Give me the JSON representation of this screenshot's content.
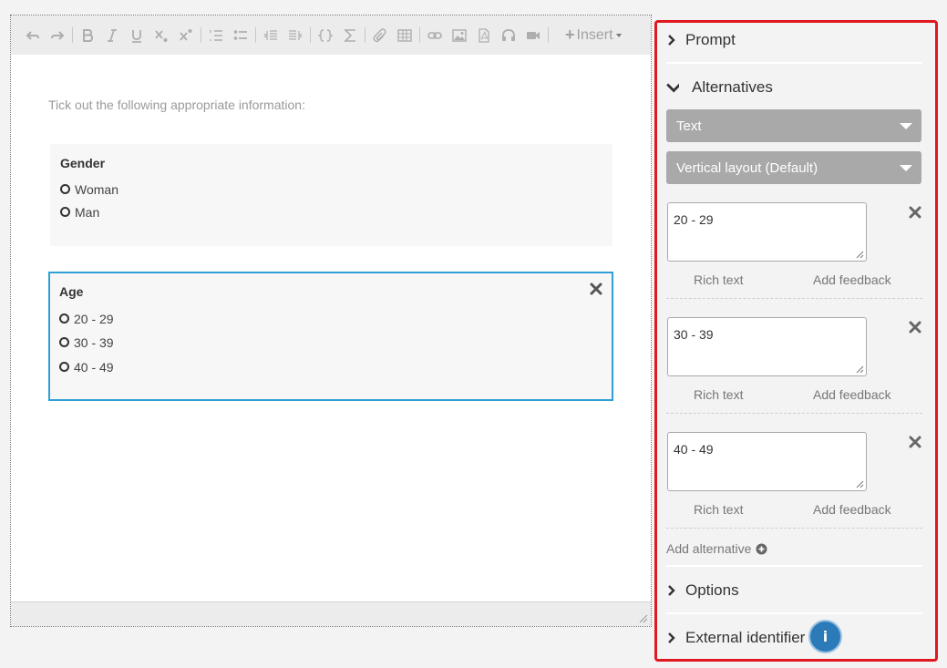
{
  "editor": {
    "insert_label": "Insert",
    "intro_text": "Tick out the following appropriate information:",
    "questions": [
      {
        "title": "Gender",
        "options": [
          "Woman",
          "Man"
        ]
      },
      {
        "title": "Age",
        "options": [
          "20 - 29",
          "30 - 39",
          "40 - 49"
        ]
      }
    ]
  },
  "panel": {
    "prompt_label": "Prompt",
    "alternatives_label": "Alternatives",
    "type_select": "Text",
    "layout_select": "Vertical layout (Default)",
    "alternatives": [
      {
        "value": "20 - 29",
        "rich_text": "Rich text",
        "feedback": "Add feedback"
      },
      {
        "value": "30 - 39",
        "rich_text": "Rich text",
        "feedback": "Add feedback"
      },
      {
        "value": "40 - 49",
        "rich_text": "Rich text",
        "feedback": "Add feedback"
      }
    ],
    "add_alternative": "Add alternative",
    "options_label": "Options",
    "external_identifier_label": "External identifier",
    "info_icon": "i"
  },
  "colors": {
    "highlight_border": "#e0181f",
    "selected_question_border": "#2f9fd7",
    "info_button": "#2b7bb9",
    "dropdown_bg": "#a9a9a9"
  }
}
